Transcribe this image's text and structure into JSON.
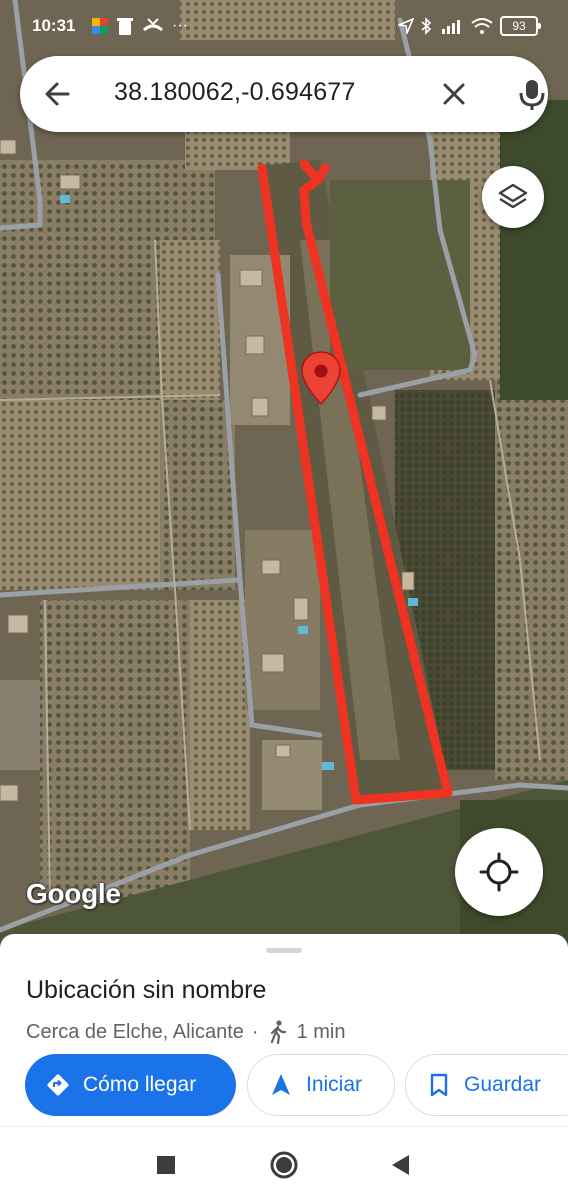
{
  "status_bar": {
    "time": "10:31",
    "battery": "93"
  },
  "search": {
    "query": "38.180062,-0.694677",
    "icons": {
      "back": "arrow-back-icon",
      "clear": "close-icon",
      "voice": "mic-icon"
    }
  },
  "map": {
    "attribution": "Google",
    "overlay_color": "#ee3322",
    "pin_color": "#ea4335",
    "buttons": {
      "layers": "layers-icon",
      "my_location": "my-location-icon"
    }
  },
  "place": {
    "title": "Ubicación sin nombre",
    "subtitle": "Cerca de Elche, Alicante",
    "separator": "·",
    "walk_time": "1 min"
  },
  "actions": {
    "directions": "Cómo llegar",
    "start": "Iniciar",
    "save": "Guardar"
  },
  "colors": {
    "accent": "#1a73e8"
  }
}
